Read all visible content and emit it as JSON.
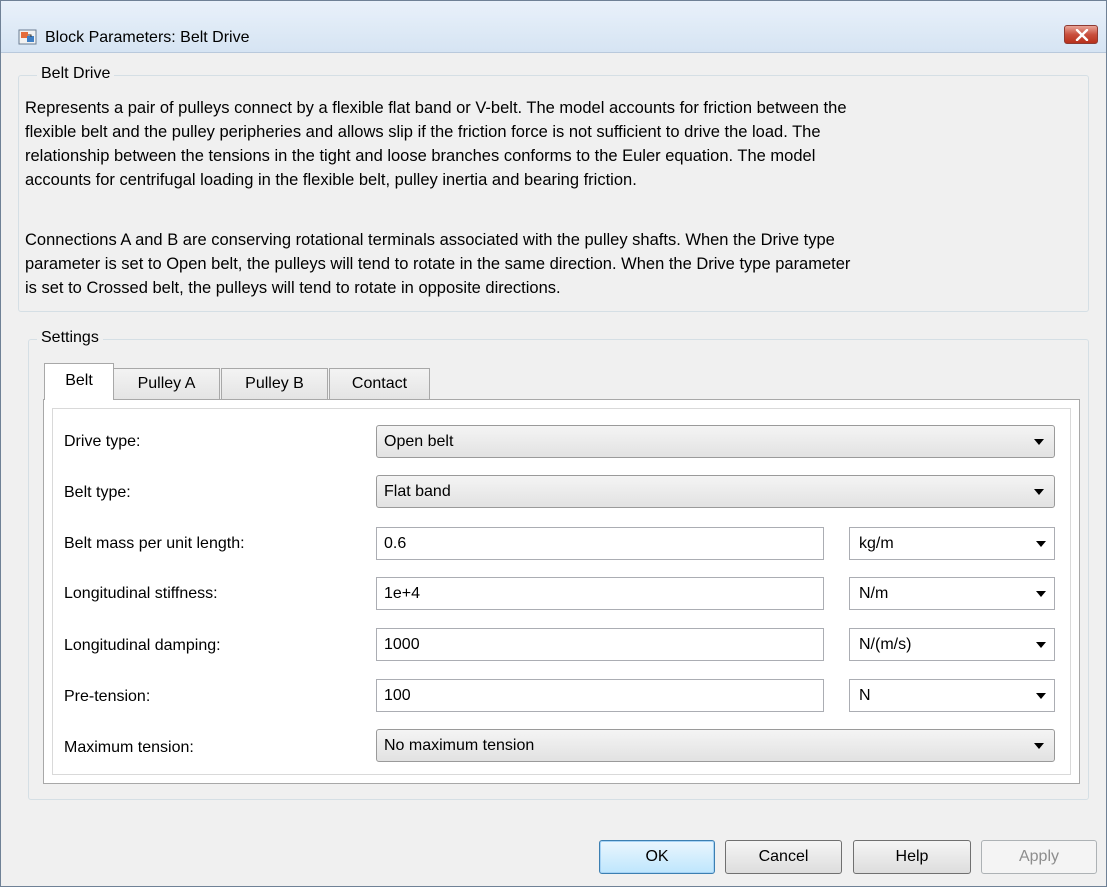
{
  "window": {
    "title": "Block Parameters: Belt Drive"
  },
  "description": {
    "group_title": "Belt Drive",
    "lines": [
      "Represents a pair of pulleys connect by a flexible flat band or V-belt. The model accounts for friction between the",
      "flexible belt and the pulley peripheries and allows slip if the friction force is not sufficient to drive the load. The",
      "relationship between the tensions in the tight and loose branches conforms to the Euler equation. The model",
      "accounts for centrifugal loading in the flexible belt, pulley inertia and bearing friction.",
      "",
      "Connections A and B are conserving rotational terminals associated with the pulley shafts. When the Drive type",
      "parameter is set to Open belt, the pulleys will tend to rotate in the same direction. When the Drive type parameter",
      "is set to Crossed belt, the pulleys will tend to rotate in opposite directions."
    ]
  },
  "settings": {
    "group_title": "Settings",
    "tabs": [
      {
        "label": "Belt",
        "active": true
      },
      {
        "label": "Pulley A",
        "active": false
      },
      {
        "label": "Pulley B",
        "active": false
      },
      {
        "label": "Contact",
        "active": false
      }
    ],
    "params": {
      "drive_type": {
        "label": "Drive type:",
        "value": "Open belt"
      },
      "belt_type": {
        "label": "Belt type:",
        "value": "Flat band"
      },
      "belt_mass": {
        "label": "Belt mass per unit length:",
        "value": "0.6",
        "unit": "kg/m"
      },
      "long_stiffness": {
        "label": "Longitudinal stiffness:",
        "value": "1e+4",
        "unit": "N/m"
      },
      "long_damping": {
        "label": "Longitudinal damping:",
        "value": "1000",
        "unit": "N/(m/s)"
      },
      "pre_tension": {
        "label": "Pre-tension:",
        "value": "100",
        "unit": "N"
      },
      "max_tension": {
        "label": "Maximum tension:",
        "value": "No maximum tension"
      }
    }
  },
  "buttons": {
    "ok": "OK",
    "cancel": "Cancel",
    "help": "Help",
    "apply": "Apply"
  },
  "icons": {
    "app": "block-parameters-icon",
    "close": "close-icon",
    "dropdown": "chevron-down-icon"
  },
  "colors": {
    "titlebar": "#dce7f4",
    "close_button": "#c9503e",
    "default_button_border": "#3c7fb1",
    "disabled_text": "#8d8d8d"
  }
}
